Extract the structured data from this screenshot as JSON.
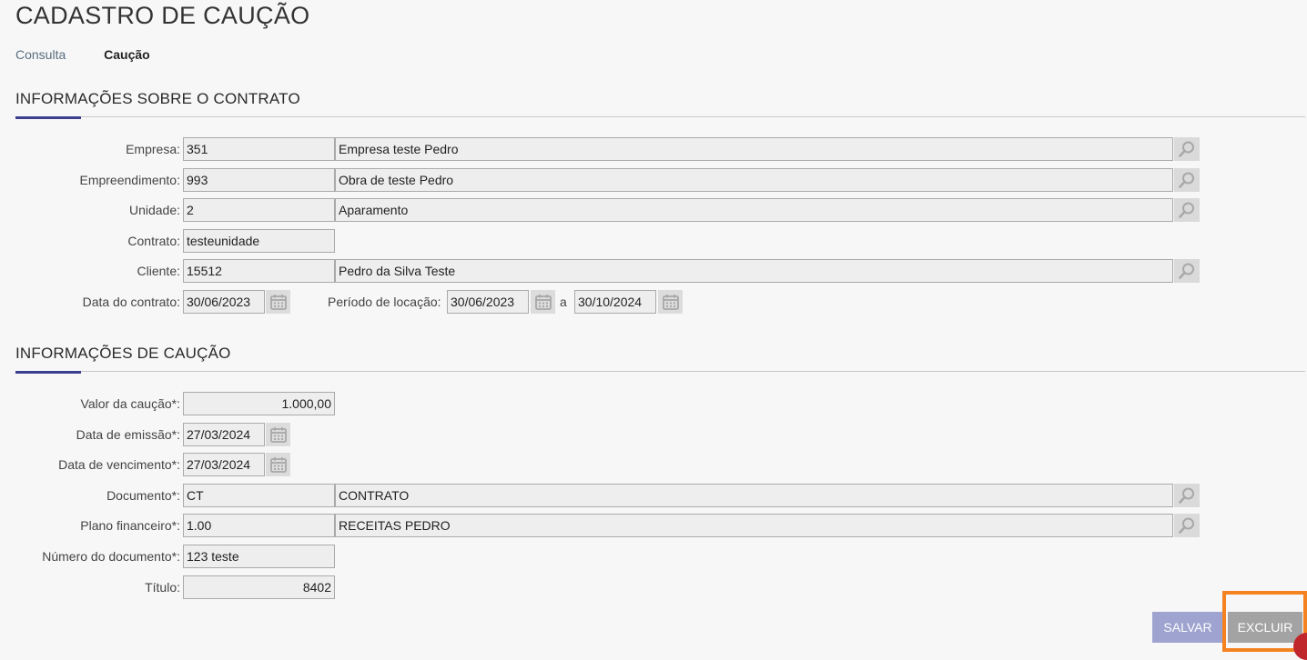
{
  "page_title": "CADASTRO DE CAUÇÃO",
  "tabs": [
    {
      "label": "Consulta",
      "active": false
    },
    {
      "label": "Caução",
      "active": true
    }
  ],
  "section_contract": {
    "title": "INFORMAÇÕES SOBRE O CONTRATO",
    "empresa": {
      "label": "Empresa:",
      "code": "351",
      "name": "Empresa teste Pedro"
    },
    "empreendimento": {
      "label": "Empreendimento:",
      "code": "993",
      "name": "Obra de teste Pedro"
    },
    "unidade": {
      "label": "Unidade:",
      "code": "2",
      "name": "Aparamento"
    },
    "contrato": {
      "label": "Contrato:",
      "value": "testeunidade"
    },
    "cliente": {
      "label": "Cliente:",
      "code": "15512",
      "name": "Pedro da Silva Teste"
    },
    "data_contrato": {
      "label": "Data do contrato:",
      "value": "30/06/2023"
    },
    "periodo_locacao": {
      "label": "Período de locação:",
      "start": "30/06/2023",
      "separator": "a",
      "end": "30/10/2024"
    }
  },
  "section_caucao": {
    "title": "INFORMAÇÕES DE CAUÇÃO",
    "valor": {
      "label": "Valor da caução*:",
      "value": "1.000,00"
    },
    "data_emissao": {
      "label": "Data de emissão*:",
      "value": "27/03/2024"
    },
    "data_vencimento": {
      "label": "Data de vencimento*:",
      "value": "27/03/2024"
    },
    "documento": {
      "label": "Documento*:",
      "code": "CT",
      "name": "CONTRATO"
    },
    "plano_financeiro": {
      "label": "Plano financeiro*:",
      "code": "1.00",
      "name": "RECEITAS PEDRO"
    },
    "numero_documento": {
      "label": "Número do documento*:",
      "value": "123 teste"
    },
    "titulo": {
      "label": "Título:",
      "value": "8402"
    }
  },
  "buttons": {
    "save": "SALVAR",
    "delete": "EXCLUIR"
  },
  "colors": {
    "accent": "#3b3f8f",
    "save_button": "#9ea3cf",
    "delete_button": "#a3a3a3",
    "highlight": "#f58220"
  },
  "icons": {
    "lookup": "magnifier-icon",
    "calendar": "calendar-icon"
  }
}
